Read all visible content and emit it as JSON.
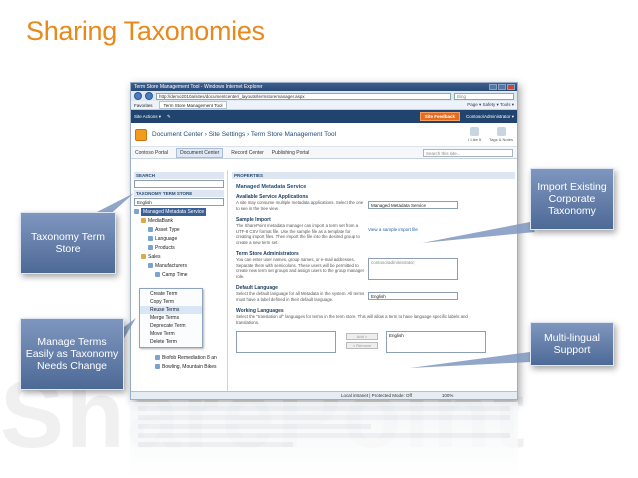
{
  "slide": {
    "title": "Sharing Taxonomies",
    "watermark": "SharePoint"
  },
  "browser": {
    "window_title": "Term Store Management Tool - Windows Internet Explorer",
    "address": "http://demo2010a/sites/documentcenter/_layouts/termstoremanager.aspx",
    "search_placeholder": "Bing",
    "favorites_label": "Favorites",
    "tab_label": "Term Store Management Tool",
    "tools_label": "Page ▾  Safety ▾  Tools ▾",
    "status_zone": "Local intranet | Protected Mode: Off",
    "status_zoom": "100%"
  },
  "sharepoint": {
    "site_actions": "Site Actions ▾",
    "site_feedback": "Site Feedback",
    "user": "Contoso\\Administrator ▾",
    "breadcrumb": "Document Center › Site Settings › Term Store Management Tool",
    "icons": [
      {
        "label": "I Like It"
      },
      {
        "label": "Tags & Notes"
      }
    ],
    "topnav": [
      {
        "label": "Contoso Portal",
        "active": false
      },
      {
        "label": "Document Center",
        "active": true
      },
      {
        "label": "Record Center",
        "active": false
      },
      {
        "label": "Publishing Portal",
        "active": false
      }
    ],
    "search_placeholder": "Search this site..."
  },
  "left_panel": {
    "search_header": "SEARCH",
    "tree_header": "TAXONOMY TERM STORE",
    "language": "English",
    "tree": [
      {
        "label": "Managed Metadata Service",
        "indent": 0,
        "selected": true,
        "group": false
      },
      {
        "label": "MediaBank",
        "indent": 1,
        "selected": false,
        "group": true
      },
      {
        "label": "Asset Type",
        "indent": 2,
        "selected": false,
        "group": false
      },
      {
        "label": "Language",
        "indent": 2,
        "selected": false,
        "group": false
      },
      {
        "label": "Products",
        "indent": 2,
        "selected": false,
        "group": false
      },
      {
        "label": "Sales",
        "indent": 1,
        "selected": false,
        "group": true
      },
      {
        "label": "Manufacturers",
        "indent": 2,
        "selected": false,
        "group": false
      },
      {
        "label": "Camp Time",
        "indent": 3,
        "selected": false,
        "group": false
      }
    ],
    "context_menu": [
      "Create Term",
      "Copy Term",
      "Reuse Terms",
      "Merge Terms",
      "Deprecate Term",
      "Move Term",
      "Delete Term"
    ],
    "tree_tail": [
      {
        "label": "Biofob Remediation 8 an",
        "indent": 3
      },
      {
        "label": "Bowling, Mountain Bikes",
        "indent": 3
      }
    ]
  },
  "main_panel": {
    "header": "PROPERTIES",
    "service_title": "Managed Metadata Service",
    "sections": [
      {
        "heading": "Available Service Applications",
        "desc": "A site may consume multiple metadata applications. Select the one to see in the tree view.",
        "field": "Managed Metadata Service",
        "kind": "field"
      },
      {
        "heading": "Sample Import",
        "desc": "The SharePoint metadata manager can import a term set from a UTF-8 CSV format file. Use the sample file as a template for creating import files. Then import the file into the desired group to create a new term set.",
        "field": "View a sample import file",
        "kind": "link"
      },
      {
        "heading": "Term Store Administrators",
        "desc": "You can enter user names, group names, or e-mail addresses. Separate them with semicolons. These users will be permitted to create new term set groups and assign users to the group manager role.",
        "field": "contoso\\administrator;",
        "kind": "tall"
      },
      {
        "heading": "Default Language",
        "desc": "Select the default language for all Metadata in the system. All terms must have a label defined in their default language.",
        "field": "English",
        "kind": "field"
      }
    ],
    "working_languages": {
      "heading": "Working Languages",
      "desc": "Select the \"translation of\" languages for terms in the term store. This will allow a term to have language specific labels and translations.",
      "add_btn": "Add >",
      "remove_btn": "< Remove",
      "selected": "English"
    }
  },
  "callouts": [
    {
      "id": "taxonomy-term-store",
      "text": "Taxonomy Term Store"
    },
    {
      "id": "manage-terms",
      "text": "Manage Terms Easily as Taxonomy Needs Change"
    },
    {
      "id": "import-taxonomy",
      "text": "Import Existing Corporate Taxonomy"
    },
    {
      "id": "multi-lingual",
      "text": "Multi-lingual Support"
    }
  ],
  "colors": {
    "title": "#e8891b",
    "callout": "#5f7aa8",
    "ribbon": "#21446e",
    "feedback": "#e86b22"
  }
}
